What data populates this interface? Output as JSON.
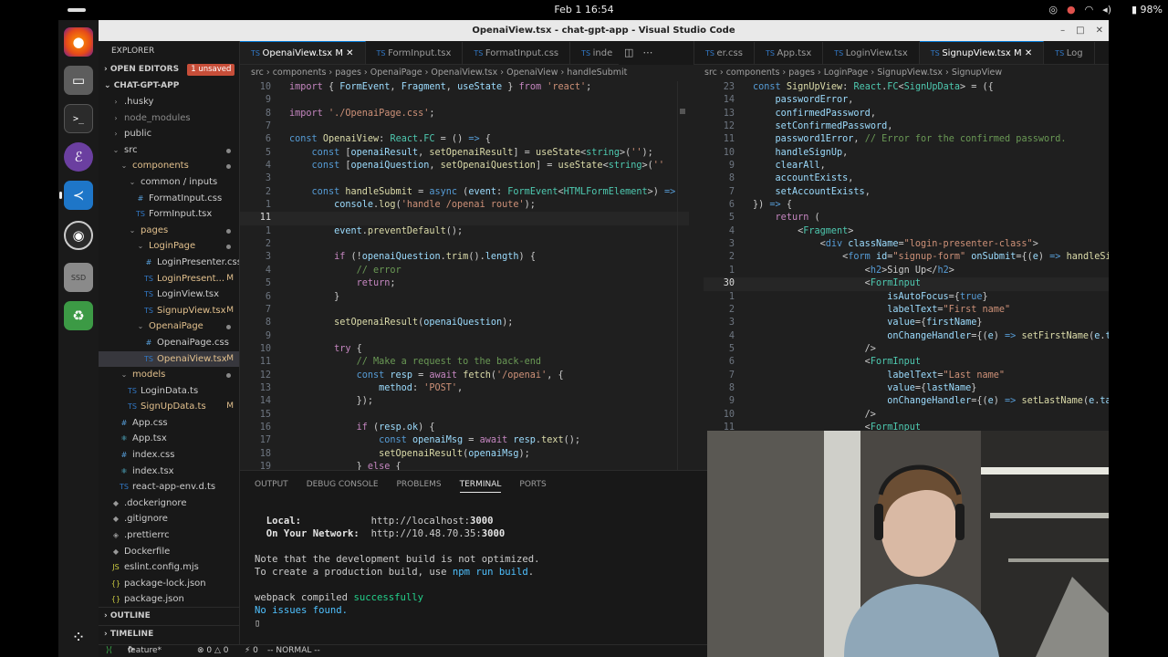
{
  "system": {
    "datetime": "Feb 1  16:54",
    "battery": "98%"
  },
  "window": {
    "title": "OpenaiView.tsx - chat-gpt-app - Visual Studio Code"
  },
  "sidebar": {
    "header": "EXPLORER",
    "open_editors": "OPEN EDITORS",
    "unsaved_badge": "1 unsaved",
    "project": "CHAT-GPT-APP",
    "tree": [
      {
        "label": ".husky",
        "depth": 1,
        "icon": "›",
        "kind": "dir",
        "dim": false
      },
      {
        "label": "node_modules",
        "depth": 1,
        "icon": "›",
        "kind": "dir",
        "dim": true
      },
      {
        "label": "public",
        "depth": 1,
        "icon": "›",
        "kind": "dir",
        "dim": false
      },
      {
        "label": "src",
        "depth": 1,
        "icon": "⌄",
        "kind": "dir",
        "dot": true
      },
      {
        "label": "components",
        "depth": 2,
        "icon": "⌄",
        "kind": "dir",
        "dot": true,
        "mod": true
      },
      {
        "label": "common / inputs",
        "depth": 3,
        "icon": "⌄",
        "kind": "dir"
      },
      {
        "label": "FormatInput.css",
        "depth": 4,
        "icon": "#",
        "kind": "css"
      },
      {
        "label": "FormInput.tsx",
        "depth": 4,
        "icon": "TS",
        "kind": "ts"
      },
      {
        "label": "pages",
        "depth": 3,
        "icon": "⌄",
        "kind": "dir",
        "dot": true,
        "mod": true
      },
      {
        "label": "LoginPage",
        "depth": 4,
        "icon": "⌄",
        "kind": "dir",
        "dot": true,
        "mod": true
      },
      {
        "label": "LoginPresenter.css",
        "depth": 5,
        "icon": "#",
        "kind": "css"
      },
      {
        "label": "LoginPresent...",
        "depth": 5,
        "icon": "TS",
        "kind": "ts",
        "status": "M",
        "mod": true
      },
      {
        "label": "LoginView.tsx",
        "depth": 5,
        "icon": "TS",
        "kind": "ts"
      },
      {
        "label": "SignupView.tsx",
        "depth": 5,
        "icon": "TS",
        "kind": "ts",
        "status": "M",
        "mod": true
      },
      {
        "label": "OpenaiPage",
        "depth": 4,
        "icon": "⌄",
        "kind": "dir",
        "dot": true,
        "mod": true
      },
      {
        "label": "OpenaiPage.css",
        "depth": 5,
        "icon": "#",
        "kind": "css"
      },
      {
        "label": "OpenaiView.tsx",
        "depth": 5,
        "icon": "TS",
        "kind": "ts",
        "status": "M",
        "mod": true,
        "selected": true
      },
      {
        "label": "models",
        "depth": 2,
        "icon": "⌄",
        "kind": "dir",
        "dot": true,
        "mod": true
      },
      {
        "label": "LoginData.ts",
        "depth": 3,
        "icon": "TS",
        "kind": "ts"
      },
      {
        "label": "SignUpData.ts",
        "depth": 3,
        "icon": "TS",
        "kind": "ts",
        "status": "M",
        "mod": true
      },
      {
        "label": "App.css",
        "depth": 2,
        "icon": "#",
        "kind": "css"
      },
      {
        "label": "App.tsx",
        "depth": 2,
        "icon": "⚛",
        "kind": "react"
      },
      {
        "label": "index.css",
        "depth": 2,
        "icon": "#",
        "kind": "css"
      },
      {
        "label": "index.tsx",
        "depth": 2,
        "icon": "⚛",
        "kind": "react"
      },
      {
        "label": "react-app-env.d.ts",
        "depth": 2,
        "icon": "TS",
        "kind": "ts"
      },
      {
        "label": ".dockerignore",
        "depth": 1,
        "icon": "◆",
        "kind": "file"
      },
      {
        "label": ".gitignore",
        "depth": 1,
        "icon": "◆",
        "kind": "file"
      },
      {
        "label": ".prettierrc",
        "depth": 1,
        "icon": "◈",
        "kind": "file"
      },
      {
        "label": "Dockerfile",
        "depth": 1,
        "icon": "◆",
        "kind": "file"
      },
      {
        "label": "eslint.config.mjs",
        "depth": 1,
        "icon": "JS",
        "kind": "js"
      },
      {
        "label": "package-lock.json",
        "depth": 1,
        "icon": "{}",
        "kind": "json"
      },
      {
        "label": "package.json",
        "depth": 1,
        "icon": "{}",
        "kind": "json"
      }
    ],
    "outline": "OUTLINE",
    "timeline": "TIMELINE"
  },
  "left_editor": {
    "tabs": [
      {
        "label": "OpenaiView.tsx M",
        "active": true
      },
      {
        "label": "FormInput.tsx",
        "active": false
      },
      {
        "label": "FormatInput.css",
        "active": false
      },
      {
        "label": "inde",
        "active": false
      }
    ],
    "breadcrumb": "src › components › pages › OpenaiPage › OpenaiView.tsx › OpenaiView › handleSubmit",
    "lines": [
      {
        "n": "10",
        "html": "<span class='kw'>import</span> { <span class='v'>FormEvent</span>, <span class='v'>Fragment</span>, <span class='v'>useState</span> } <span class='kw'>from</span> <span class='s'>'react'</span>;"
      },
      {
        "n": "9",
        "html": ""
      },
      {
        "n": "8",
        "html": "<span class='kw'>import</span> <span class='s'>'./OpenaiPage.css'</span>;"
      },
      {
        "n": "7",
        "html": ""
      },
      {
        "n": "6",
        "html": "<span class='k'>const</span> <span class='f'>OpenaiView</span>: <span class='ty'>React</span>.<span class='ty'>FC</span> = () <span class='k'>=&gt;</span> {"
      },
      {
        "n": "5",
        "html": "    <span class='k'>const</span> [<span class='v'>openaiResult</span>, <span class='f'>setOpenaiResult</span>] = <span class='f'>useState</span>&lt;<span class='ty'>string</span>&gt;(<span class='s'>''</span>);"
      },
      {
        "n": "4",
        "html": "    <span class='k'>const</span> [<span class='v'>openaiQuestion</span>, <span class='f'>setOpenaiQuestion</span>] = <span class='f'>useState</span>&lt;<span class='ty'>string</span>&gt;(<span class='s'>''</span>"
      },
      {
        "n": "3",
        "html": ""
      },
      {
        "n": "2",
        "html": "    <span class='k'>const</span> <span class='f'>handleSubmit</span> = <span class='k'>async</span> (<span class='v'>event</span>: <span class='ty'>FormEvent</span>&lt;<span class='ty'>HTMLFormElement</span>&gt;) <span class='k'>=&gt;</span>"
      },
      {
        "n": "1",
        "html": "        <span class='v'>console</span>.<span class='f'>log</span>(<span class='s'>'handle /openai route'</span>);"
      },
      {
        "n": "11",
        "html": "",
        "cur": true
      },
      {
        "n": "1",
        "html": "        <span class='v'>event</span>.<span class='f'>preventDefault</span>();"
      },
      {
        "n": "2",
        "html": ""
      },
      {
        "n": "3",
        "html": "        <span class='kw'>if</span> (!<span class='v'>openaiQuestion</span>.<span class='f'>trim</span>().<span class='v'>length</span>) {"
      },
      {
        "n": "4",
        "html": "            <span class='c'>// error</span>"
      },
      {
        "n": "5",
        "html": "            <span class='kw'>return</span>;"
      },
      {
        "n": "6",
        "html": "        }"
      },
      {
        "n": "7",
        "html": ""
      },
      {
        "n": "8",
        "html": "        <span class='f'>setOpenaiResult</span>(<span class='v'>openaiQuestion</span>);"
      },
      {
        "n": "9",
        "html": ""
      },
      {
        "n": "10",
        "html": "        <span class='kw'>try</span> {"
      },
      {
        "n": "11",
        "html": "            <span class='c'>// Make a request to the back-end</span>"
      },
      {
        "n": "12",
        "html": "            <span class='k'>const</span> <span class='v'>resp</span> = <span class='kw'>await</span> <span class='f'>fetch</span>(<span class='s'>'/openai'</span>, {"
      },
      {
        "n": "13",
        "html": "                <span class='v'>method</span>: <span class='s'>'POST'</span>,"
      },
      {
        "n": "14",
        "html": "            });"
      },
      {
        "n": "15",
        "html": ""
      },
      {
        "n": "16",
        "html": "            <span class='kw'>if</span> (<span class='v'>resp</span>.<span class='v'>ok</span>) {"
      },
      {
        "n": "17",
        "html": "                <span class='k'>const</span> <span class='v'>openaiMsg</span> = <span class='kw'>await</span> <span class='v'>resp</span>.<span class='f'>text</span>();"
      },
      {
        "n": "18",
        "html": "                <span class='f'>setOpenaiResult</span>(<span class='v'>openaiMsg</span>);"
      },
      {
        "n": "19",
        "html": "            } <span class='kw'>else</span> {"
      }
    ]
  },
  "right_editor": {
    "tabs": [
      {
        "label": "er.css",
        "active": false
      },
      {
        "label": "App.tsx",
        "active": false
      },
      {
        "label": "LoginView.tsx",
        "active": false
      },
      {
        "label": "SignupView.tsx M",
        "active": true
      },
      {
        "label": "Log",
        "active": false
      }
    ],
    "breadcrumb": "src › components › pages › LoginPage › SignupView.tsx › SignupView",
    "lines": [
      {
        "n": "23",
        "html": "<span class='k'>const</span> <span class='f'>SignUpView</span>: <span class='ty'>React</span>.<span class='ty'>FC</span>&lt;<span class='ty'>SignUpData</span>&gt; = ({"
      },
      {
        "n": "14",
        "html": "    <span class='v'>passwordError</span>,"
      },
      {
        "n": "13",
        "html": "    <span class='v'>confirmedPassword</span>,"
      },
      {
        "n": "12",
        "html": "    <span class='v'>setConfirmedPassword</span>,"
      },
      {
        "n": "11",
        "html": "    <span class='v'>password1Error</span>, <span class='c'>// Error for the confirmed password.</span>"
      },
      {
        "n": "10",
        "html": "    <span class='v'>handleSignUp</span>,"
      },
      {
        "n": "9",
        "html": "    <span class='v'>clearAll</span>,"
      },
      {
        "n": "8",
        "html": "    <span class='v'>accountExists</span>,"
      },
      {
        "n": "7",
        "html": "    <span class='v'>setAccountExists</span>,"
      },
      {
        "n": "6",
        "html": "}) <span class='k'>=&gt;</span> {"
      },
      {
        "n": "5",
        "html": "    <span class='kw'>return</span> ("
      },
      {
        "n": "4",
        "html": "        &lt;<span class='ty'>Fragment</span>&gt;"
      },
      {
        "n": "3",
        "html": "            &lt;<span class='tg'>div</span> <span class='at'>className</span>=<span class='s'>\"login-presenter-class\"</span>&gt;"
      },
      {
        "n": "2",
        "html": "                &lt;<span class='tg'>form</span> <span class='at'>id</span>=<span class='s'>\"signup-form\"</span> <span class='at'>onSubmit</span>={(<span class='v'>e</span>) <span class='k'>=&gt;</span> <span class='f'>handleSi</span>"
      },
      {
        "n": "1",
        "html": "                    &lt;<span class='tg'>h2</span>&gt;Sign Up&lt;/<span class='tg'>h2</span>&gt;"
      },
      {
        "n": "30",
        "html": "                    &lt;<span class='ty'>FormInput</span>",
        "cur": true
      },
      {
        "n": "1",
        "html": "                        <span class='at'>isAutoFocus</span>={<span class='k'>true</span>}"
      },
      {
        "n": "2",
        "html": "                        <span class='at'>labelText</span>=<span class='s'>\"First name\"</span>"
      },
      {
        "n": "3",
        "html": "                        <span class='at'>value</span>={<span class='v'>firstName</span>}"
      },
      {
        "n": "4",
        "html": "                        <span class='at'>onChangeHandler</span>={(<span class='v'>e</span>) <span class='k'>=&gt;</span> <span class='f'>setFirstName</span>(<span class='v'>e</span>.<span class='v'>t</span>"
      },
      {
        "n": "5",
        "html": "                    /&gt;"
      },
      {
        "n": "6",
        "html": "                    &lt;<span class='ty'>FormInput</span>"
      },
      {
        "n": "7",
        "html": "                        <span class='at'>labelText</span>=<span class='s'>\"Last name\"</span>"
      },
      {
        "n": "8",
        "html": "                        <span class='at'>value</span>={<span class='v'>lastName</span>}"
      },
      {
        "n": "9",
        "html": "                        <span class='at'>onChangeHandler</span>={(<span class='v'>e</span>) <span class='k'>=&gt;</span> <span class='f'>setLastName</span>(<span class='v'>e</span>.<span class='v'>ta</span>"
      },
      {
        "n": "10",
        "html": "                    /&gt;"
      },
      {
        "n": "11",
        "html": "                    &lt;<span class='ty'>FormInput</span>"
      }
    ]
  },
  "panel": {
    "tabs": [
      {
        "label": "OUTPUT",
        "active": false
      },
      {
        "label": "DEBUG CONSOLE",
        "active": false
      },
      {
        "label": "PROBLEMS",
        "active": false
      },
      {
        "label": "TERMINAL",
        "active": true
      },
      {
        "label": "PORTS",
        "active": false
      }
    ],
    "terminal": [
      {
        "html": ""
      },
      {
        "html": "  <b style='color:#e5e5e5'>Local:</b>            http://localhost:<b style='color:#e5e5e5'>3000</b>"
      },
      {
        "html": "  <b style='color:#e5e5e5'>On Your Network:</b>  http://10.48.70.35:<b style='color:#e5e5e5'>3000</b>"
      },
      {
        "html": ""
      },
      {
        "html": "Note that the development build is not optimized."
      },
      {
        "html": "To create a production build, use <span style='color:#4fc1ff'>npm run build</span>."
      },
      {
        "html": ""
      },
      {
        "html": "webpack compiled <span style='color:#23d18b'>successfully</span>"
      },
      {
        "html": "<span style='color:#4fc1ff'>No issues found.</span>"
      },
      {
        "html": "▯"
      }
    ]
  },
  "statusbar": {
    "branch": "feature*",
    "errors": "⊗ 0 △ 0",
    "ports": "⚡ 0",
    "mode": "-- NORMAL --"
  },
  "colors": {
    "accent": "#0078d4",
    "modified": "#e2c08d",
    "badge": "#c74e39"
  }
}
